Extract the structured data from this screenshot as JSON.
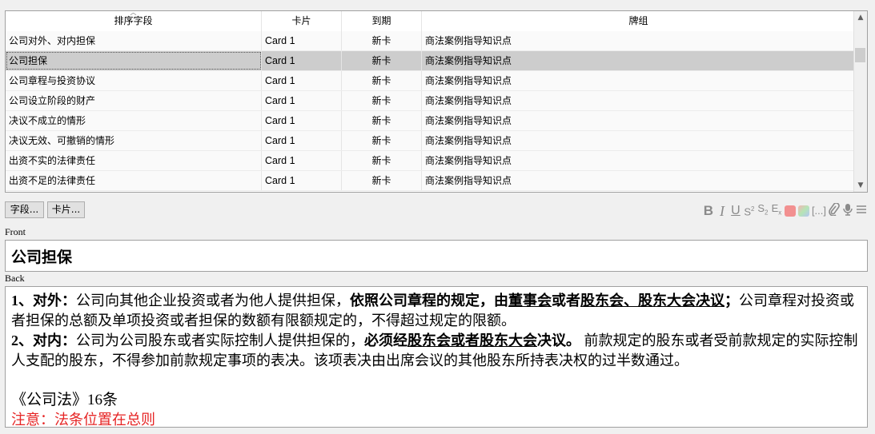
{
  "table": {
    "columns": [
      "排序字段",
      "卡片",
      "到期",
      "牌组"
    ],
    "rows": [
      {
        "sort_field": "公司对外、对内担保",
        "card": "Card 1",
        "due": "新卡",
        "deck": "商法案例指导知识点",
        "selected": false
      },
      {
        "sort_field": "公司担保",
        "card": "Card 1",
        "due": "新卡",
        "deck": "商法案例指导知识点",
        "selected": true
      },
      {
        "sort_field": "公司章程与投资协议",
        "card": "Card 1",
        "due": "新卡",
        "deck": "商法案例指导知识点",
        "selected": false
      },
      {
        "sort_field": "公司设立阶段的财产",
        "card": "Card 1",
        "due": "新卡",
        "deck": "商法案例指导知识点",
        "selected": false
      },
      {
        "sort_field": "决议不成立的情形",
        "card": "Card 1",
        "due": "新卡",
        "deck": "商法案例指导知识点",
        "selected": false
      },
      {
        "sort_field": "决议无效、可撤销的情形",
        "card": "Card 1",
        "due": "新卡",
        "deck": "商法案例指导知识点",
        "selected": false
      },
      {
        "sort_field": "出资不实的法律责任",
        "card": "Card 1",
        "due": "新卡",
        "deck": "商法案例指导知识点",
        "selected": false
      },
      {
        "sort_field": "出资不足的法律责任",
        "card": "Card 1",
        "due": "新卡",
        "deck": "商法案例指导知识点",
        "selected": false
      }
    ]
  },
  "buttons": {
    "fields": "字段...",
    "cards": "卡片..."
  },
  "toolbar": {
    "bold": "B",
    "italic": "I",
    "underline": "U",
    "superscript": "S",
    "superscript_mark": "2",
    "subscript": "S",
    "subscript_mark": "2",
    "clear_format": "E",
    "clear_format_mark": "x",
    "cloze": "[...]",
    "text_color": "#f29090",
    "icons": [
      "bold-icon",
      "italic-icon",
      "underline-icon",
      "superscript-icon",
      "subscript-icon",
      "clear-format-icon",
      "text-color-icon",
      "highlight-color-icon",
      "cloze-icon",
      "attachment-icon",
      "record-audio-icon",
      "menu-icon"
    ]
  },
  "editor": {
    "front_label": "Front",
    "front_value": "公司担保",
    "back_label": "Back",
    "back": {
      "p1": {
        "num": "1、",
        "head": "对外：",
        "text1": "公司向其他企业投资或者为他人提供担保，",
        "bold1": "依照公司章程的规定，由",
        "u1": "董事会",
        "bold2": "或者",
        "u2": "股东会、股东大会决议",
        "bold3": "；",
        "text2": "公司章程对投资或者担保的总额及单项投资或者担保的数额有限额规定的，不得超过规定的限额。"
      },
      "p2": {
        "num": "2、",
        "head": "对内：",
        "text1": "公司为公司股东或者实际控制人提供担保的，",
        "bold1": "必须经",
        "u1": "股东会或者股东大会",
        "bold2": "决议。",
        "text2": " 前款规定的股东或者受前款规定的实际控制人支配的股东，不得参加前款规定事项的表决。该项表决由出席会议的其他股东所持表决权的过半数通过。"
      },
      "law_ref": "《公司法》16条",
      "note": "注意：法条位置在总则"
    }
  }
}
